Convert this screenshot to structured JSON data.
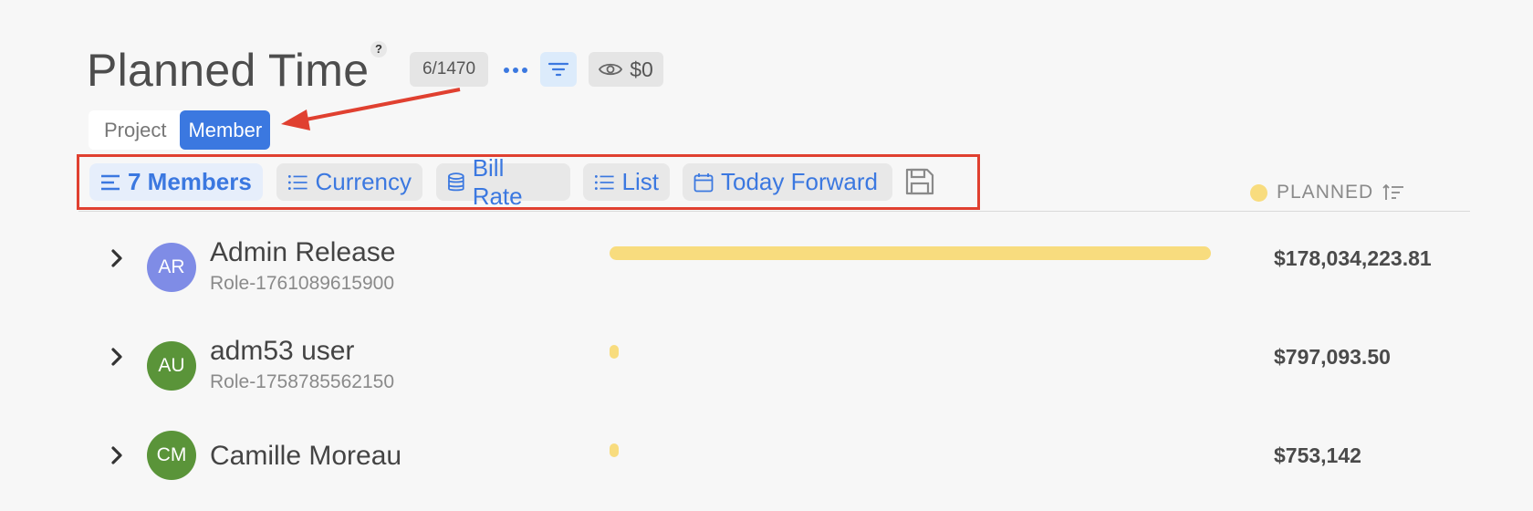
{
  "header": {
    "title": "Planned Time",
    "help": "?",
    "count": "6/1470",
    "value": "$0"
  },
  "toggle": {
    "project": "Project",
    "member": "Member"
  },
  "toolbar": {
    "members": "7 Members",
    "currency": "Currency",
    "bill_rate": "Bill Rate",
    "list": "List",
    "date_range": "Today Forward"
  },
  "column": {
    "planned": "PLANNED"
  },
  "colors": {
    "accent": "#3b78e0",
    "annotation": "#e04030",
    "bar": "#f8dc7e"
  },
  "rows": [
    {
      "initials": "AR",
      "name": "Admin Release",
      "role": "Role-1761089615900",
      "amount": "$178,034,223.81",
      "avatar_color": "#7f8ce6",
      "planned_fraction": 1.0
    },
    {
      "initials": "AU",
      "name": "adm53 user",
      "role": "Role-1758785562150",
      "amount": "$797,093.50",
      "avatar_color": "#5a9439",
      "planned_fraction": 0.0045
    },
    {
      "initials": "CM",
      "name": "Camille Moreau",
      "role": "",
      "amount": "$753,142",
      "avatar_color": "#5a9439",
      "planned_fraction": 0.0042
    }
  ]
}
